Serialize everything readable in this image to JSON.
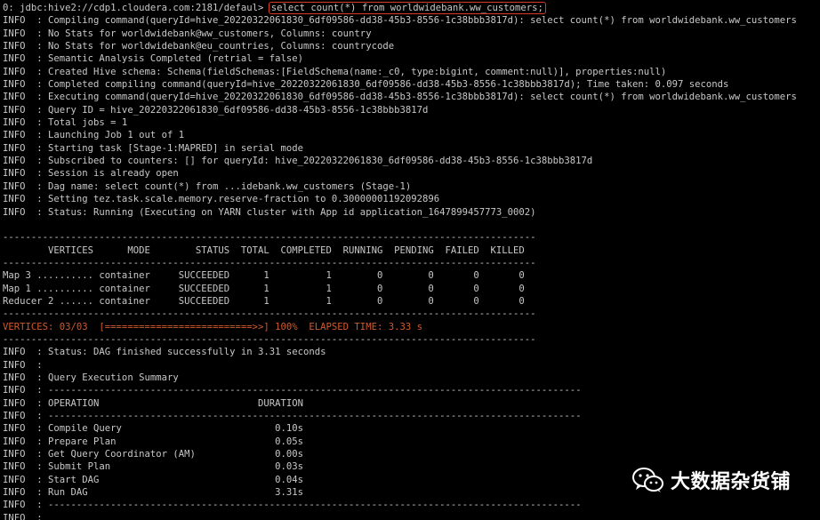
{
  "terminal": {
    "lines": [
      {
        "t": "0: jdbc:hive2://cdp1.cloudera.com:2181/defaul> ",
        "cmd": "select count(*) from worldwidebank.ww_customers;"
      },
      {
        "t": "INFO  : Compiling command(queryId=hive_20220322061830_6df09586-dd38-45b3-8556-1c38bbb3817d): select count(*) from worldwidebank.ww_customers"
      },
      {
        "t": "INFO  : No Stats for worldwidebank@ww_customers, Columns: country"
      },
      {
        "t": "INFO  : No Stats for worldwidebank@eu_countries, Columns: countrycode"
      },
      {
        "t": "INFO  : Semantic Analysis Completed (retrial = false)"
      },
      {
        "t": "INFO  : Created Hive schema: Schema(fieldSchemas:[FieldSchema(name:_c0, type:bigint, comment:null)], properties:null)"
      },
      {
        "t": "INFO  : Completed compiling command(queryId=hive_20220322061830_6df09586-dd38-45b3-8556-1c38bbb3817d); Time taken: 0.097 seconds"
      },
      {
        "t": "INFO  : Executing command(queryId=hive_20220322061830_6df09586-dd38-45b3-8556-1c38bbb3817d): select count(*) from worldwidebank.ww_customers"
      },
      {
        "t": "INFO  : Query ID = hive_20220322061830_6df09586-dd38-45b3-8556-1c38bbb3817d"
      },
      {
        "t": "INFO  : Total jobs = 1"
      },
      {
        "t": "INFO  : Launching Job 1 out of 1"
      },
      {
        "t": "INFO  : Starting task [Stage-1:MAPRED] in serial mode"
      },
      {
        "t": "INFO  : Subscribed to counters: [] for queryId: hive_20220322061830_6df09586-dd38-45b3-8556-1c38bbb3817d"
      },
      {
        "t": "INFO  : Session is already open"
      },
      {
        "t": "INFO  : Dag name: select count(*) from ...idebank.ww_customers (Stage-1)"
      },
      {
        "t": "INFO  : Setting tez.task.scale.memory.reserve-fraction to 0.30000001192092896"
      },
      {
        "t": "INFO  : Status: Running (Executing on YARN cluster with App id application_1647899457773_0002)"
      },
      {
        "t": ""
      },
      {
        "t": "----------------------------------------------------------------------------------------------"
      },
      {
        "t": "        VERTICES      MODE        STATUS  TOTAL  COMPLETED  RUNNING  PENDING  FAILED  KILLED"
      },
      {
        "t": "----------------------------------------------------------------------------------------------"
      },
      {
        "t": "Map 3 .......... container     SUCCEEDED      1          1        0        0       0       0"
      },
      {
        "t": "Map 1 .......... container     SUCCEEDED      1          1        0        0       0       0"
      },
      {
        "t": "Reducer 2 ...... container     SUCCEEDED      1          1        0        0       0       0"
      },
      {
        "t": "----------------------------------------------------------------------------------------------"
      },
      {
        "t": "VERTICES: 03/03  [==========================>>] 100%  ELAPSED TIME: 3.33 s",
        "hl": true
      },
      {
        "t": "----------------------------------------------------------------------------------------------"
      },
      {
        "t": "INFO  : Status: DAG finished successfully in 3.31 seconds"
      },
      {
        "t": "INFO  :"
      },
      {
        "t": "INFO  : Query Execution Summary"
      },
      {
        "t": "INFO  : ----------------------------------------------------------------------------------------------"
      },
      {
        "t": "INFO  : OPERATION                            DURATION"
      },
      {
        "t": "INFO  : ----------------------------------------------------------------------------------------------"
      },
      {
        "t": "INFO  : Compile Query                           0.10s"
      },
      {
        "t": "INFO  : Prepare Plan                            0.05s"
      },
      {
        "t": "INFO  : Get Query Coordinator (AM)              0.00s"
      },
      {
        "t": "INFO  : Submit Plan                             0.03s"
      },
      {
        "t": "INFO  : Start DAG                               0.04s"
      },
      {
        "t": "INFO  : Run DAG                                 3.31s"
      },
      {
        "t": "INFO  : ----------------------------------------------------------------------------------------------"
      },
      {
        "t": "INFO  :"
      }
    ]
  },
  "watermark": {
    "icon": "wechat-icon",
    "text": "大数据杂货铺"
  },
  "colors": {
    "background": "#000000",
    "text": "#c8c8c8",
    "highlight": "#d05a2e",
    "command_box": "#d83a2a"
  }
}
